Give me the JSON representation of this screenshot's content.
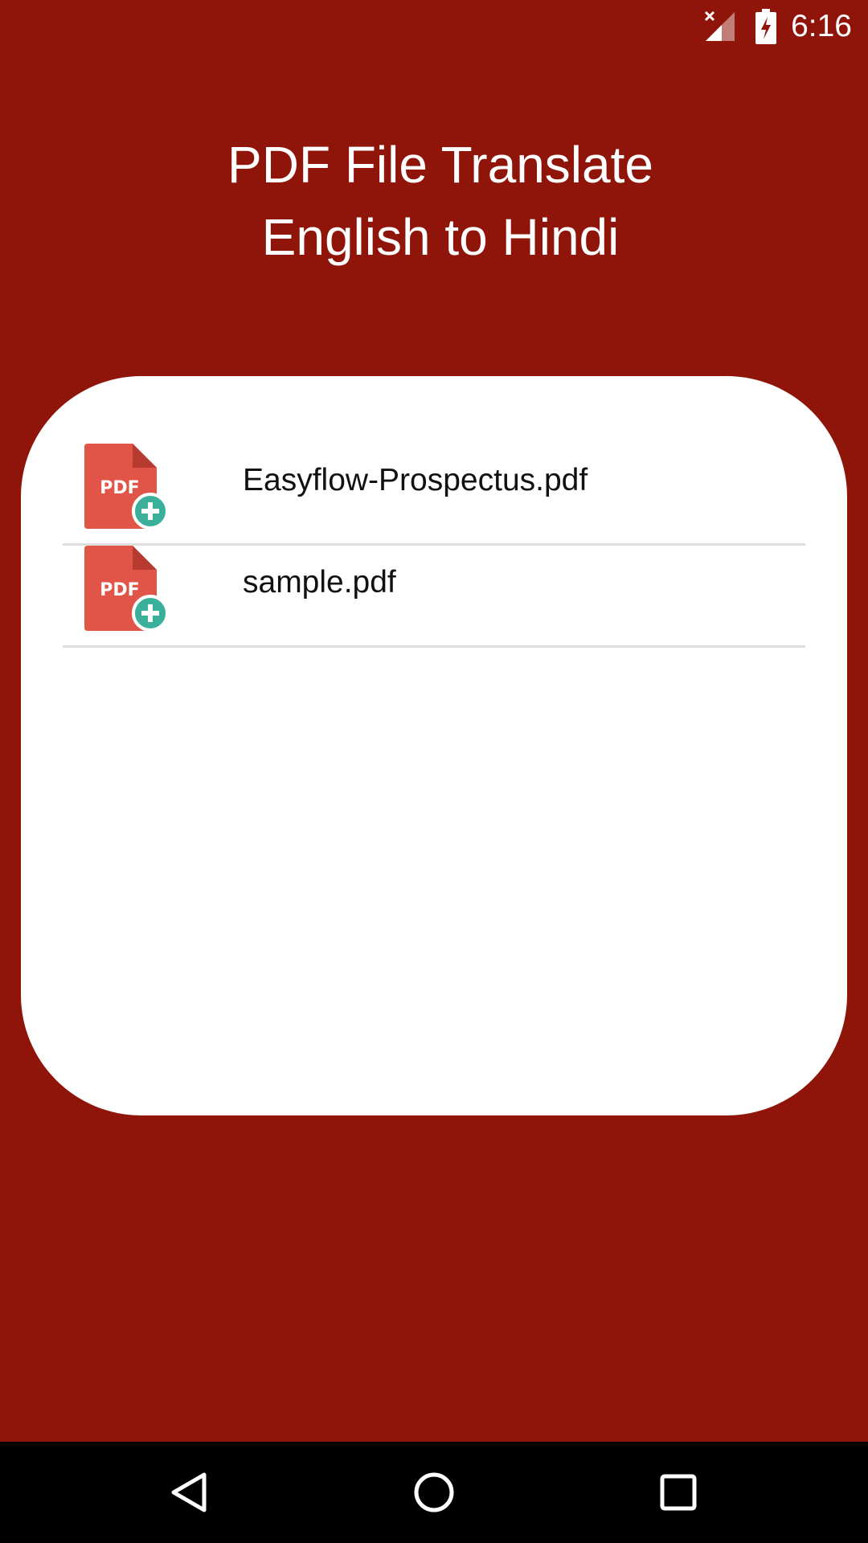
{
  "status_bar": {
    "time": "6:16",
    "icons": [
      "signal-no-service-icon",
      "battery-charging-icon"
    ]
  },
  "header": {
    "title_line1": "PDF File Translate",
    "title_line2": "English to Hindi"
  },
  "files": [
    {
      "name": "Easyflow-Prospectus.pdf",
      "icon": "pdf-add-icon",
      "icon_label": "PDF"
    },
    {
      "name": "sample.pdf",
      "icon": "pdf-add-icon",
      "icon_label": "PDF"
    }
  ],
  "nav_bar": {
    "buttons": [
      "back-icon",
      "home-icon",
      "recent-apps-icon"
    ]
  },
  "colors": {
    "background": "#8f1409",
    "card": "#ffffff",
    "pdf_icon": "#e05548",
    "pdf_icon_fold": "#b63a2f",
    "plus_badge": "#3aaf9a",
    "divider": "#dedede",
    "nav_bar": "#000000"
  }
}
